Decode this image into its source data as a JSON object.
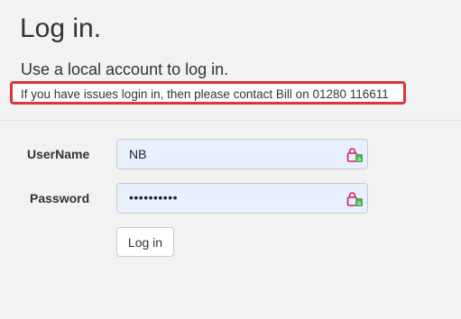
{
  "page": {
    "title": "Log in.",
    "subtitle": "Use a local account to log in.",
    "notice": "If you have issues login in, then please contact Bill on 01280 116611"
  },
  "form": {
    "username_label": "UserName",
    "username_value": "NB",
    "password_label": "Password",
    "password_value": "••••••••••",
    "submit_label": "Log in"
  },
  "icons": {
    "field_icon": "password-manager-lock-icon"
  },
  "colors": {
    "notice_border": "#d9363e",
    "input_autofill_bg": "#e8f0fe",
    "lock_icon_red": "#d81b60",
    "lock_icon_green": "#4caf50"
  }
}
